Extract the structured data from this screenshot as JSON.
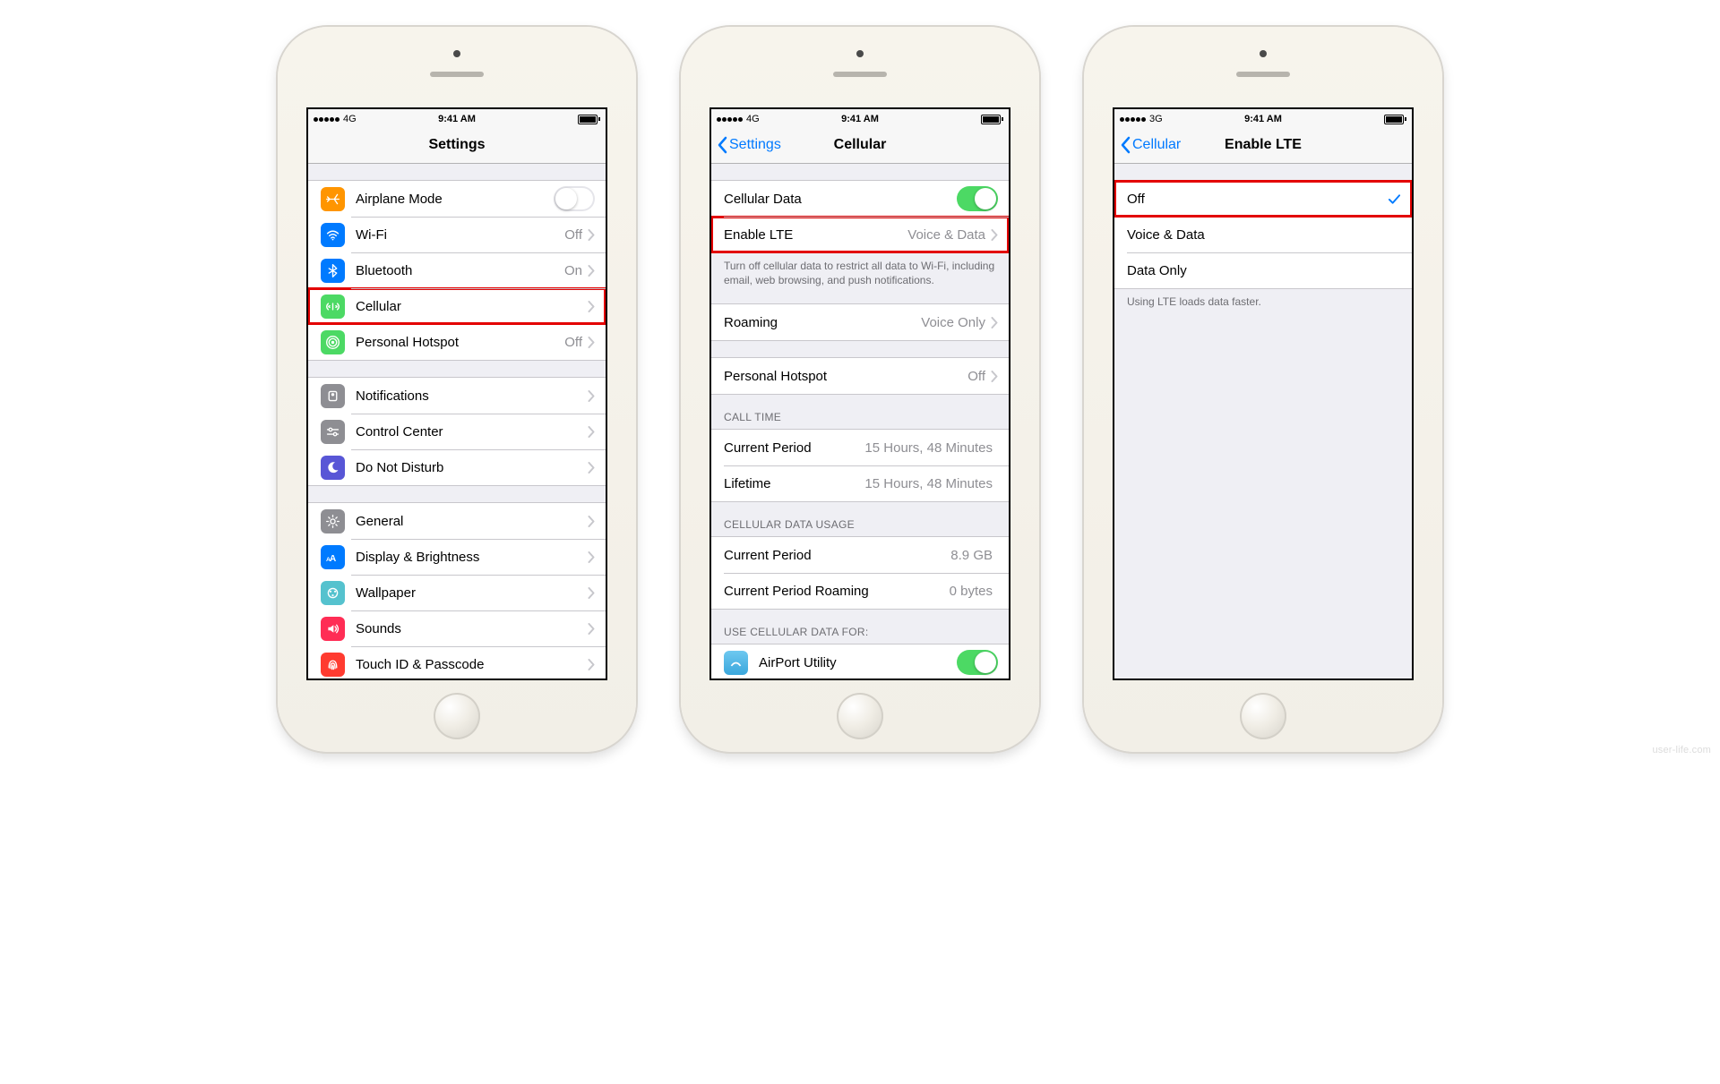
{
  "watermark": "user-life.com",
  "phone1": {
    "status": {
      "net": "4G",
      "time": "9:41 AM"
    },
    "nav": {
      "title": "Settings"
    },
    "g1": [
      {
        "label": "Airplane Mode",
        "type": "toggle",
        "on": false,
        "color": "#ff9500",
        "icon": "airplane"
      },
      {
        "label": "Wi-Fi",
        "value": "Off",
        "type": "link",
        "color": "#007aff",
        "icon": "wifi"
      },
      {
        "label": "Bluetooth",
        "value": "On",
        "type": "link",
        "color": "#007aff",
        "icon": "bluetooth"
      },
      {
        "label": "Cellular",
        "type": "link",
        "highlight": true,
        "color": "#4cd964",
        "icon": "cellular"
      },
      {
        "label": "Personal Hotspot",
        "value": "Off",
        "type": "link",
        "color": "#4cd964",
        "icon": "hotspot"
      }
    ],
    "g2": [
      {
        "label": "Notifications",
        "type": "link",
        "color": "#8e8e93",
        "icon": "bell"
      },
      {
        "label": "Control Center",
        "type": "link",
        "color": "#8e8e93",
        "icon": "control"
      },
      {
        "label": "Do Not Disturb",
        "type": "link",
        "color": "#5856d6",
        "icon": "moon"
      }
    ],
    "g3": [
      {
        "label": "General",
        "type": "link",
        "color": "#8e8e93",
        "icon": "gear"
      },
      {
        "label": "Display & Brightness",
        "type": "link",
        "color": "#007aff",
        "icon": "display"
      },
      {
        "label": "Wallpaper",
        "type": "link",
        "color": "#55c2ce",
        "icon": "wallpaper"
      },
      {
        "label": "Sounds",
        "type": "link",
        "color": "#ff2d55",
        "icon": "sound"
      },
      {
        "label": "Touch ID & Passcode",
        "type": "link",
        "color": "#ff3b30",
        "icon": "touchid"
      }
    ]
  },
  "phone2": {
    "status": {
      "net": "4G",
      "time": "9:41 AM"
    },
    "nav": {
      "back": "Settings",
      "title": "Cellular"
    },
    "g1": {
      "rows": [
        {
          "label": "Cellular Data",
          "type": "toggle",
          "on": true
        },
        {
          "label": "Enable LTE",
          "value": "Voice & Data",
          "type": "link",
          "highlight": true
        }
      ],
      "footer": "Turn off cellular data to restrict all data to Wi-Fi, including email, web browsing, and push notifications."
    },
    "g2": [
      {
        "label": "Roaming",
        "value": "Voice Only",
        "type": "link"
      }
    ],
    "g3": [
      {
        "label": "Personal Hotspot",
        "value": "Off",
        "type": "link"
      }
    ],
    "g4": {
      "header": "CALL TIME",
      "rows": [
        {
          "label": "Current Period",
          "value": "15 Hours, 48 Minutes"
        },
        {
          "label": "Lifetime",
          "value": "15 Hours, 48 Minutes"
        }
      ]
    },
    "g5": {
      "header": "CELLULAR DATA USAGE",
      "rows": [
        {
          "label": "Current Period",
          "value": "8.9 GB"
        },
        {
          "label": "Current Period Roaming",
          "value": "0 bytes"
        }
      ]
    },
    "g6": {
      "header": "USE CELLULAR DATA FOR:",
      "rows": [
        {
          "label": "AirPort Utility",
          "type": "toggle",
          "on": true,
          "appicon": true
        }
      ]
    }
  },
  "phone3": {
    "status": {
      "net": "3G",
      "time": "9:41 AM"
    },
    "nav": {
      "back": "Cellular",
      "title": "Enable LTE"
    },
    "rows": [
      {
        "label": "Off",
        "checked": true,
        "highlight": true
      },
      {
        "label": "Voice & Data"
      },
      {
        "label": "Data Only"
      }
    ],
    "footer": "Using LTE loads data faster."
  }
}
